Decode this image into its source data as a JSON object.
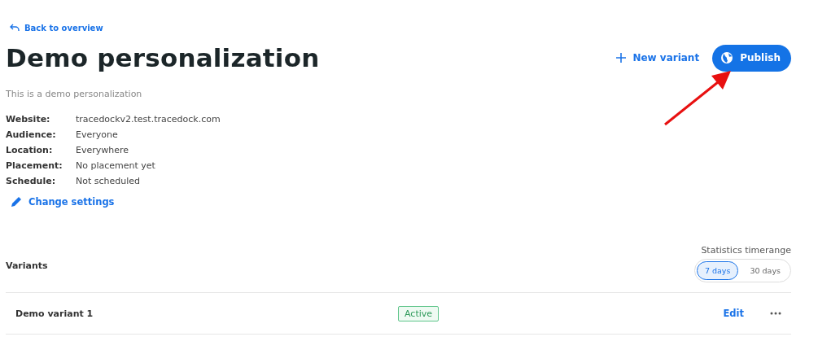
{
  "back_link": "Back to overview",
  "title": "Demo personalization",
  "actions": {
    "new_variant": "New variant",
    "publish": "Publish"
  },
  "description": "This is a demo personalization",
  "details": [
    {
      "label": "Website:",
      "value": "tracedockv2.test.tracedock.com"
    },
    {
      "label": "Audience:",
      "value": "Everyone"
    },
    {
      "label": "Location:",
      "value": "Everywhere"
    },
    {
      "label": "Placement:",
      "value": "No placement yet"
    },
    {
      "label": "Schedule:",
      "value": "Not scheduled"
    }
  ],
  "change_settings": "Change settings",
  "variants": {
    "heading": "Variants",
    "timerange_label": "Statistics timerange",
    "timerange_options": [
      {
        "label": "7 days",
        "selected": true
      },
      {
        "label": "30 days",
        "selected": false
      }
    ],
    "rows": [
      {
        "name": "Demo variant 1",
        "status": "Active",
        "edit": "Edit"
      }
    ]
  }
}
